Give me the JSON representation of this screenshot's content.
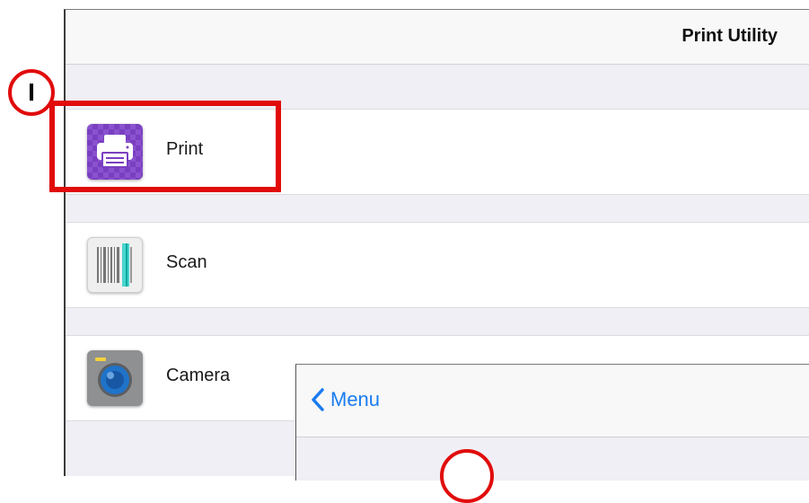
{
  "nav": {
    "title": "Print Utility"
  },
  "menu": {
    "items": [
      {
        "label": "Print",
        "icon": "printer-icon"
      },
      {
        "label": "Scan",
        "icon": "scanner-icon"
      },
      {
        "label": "Camera",
        "icon": "camera-icon"
      }
    ]
  },
  "overlay": {
    "back_label": "Menu"
  },
  "callouts": {
    "step1": "I"
  },
  "colors": {
    "highlight": "#e10b0b",
    "ios_blue": "#1a7cf0",
    "print_icon_bg": "#7a3fc1"
  }
}
